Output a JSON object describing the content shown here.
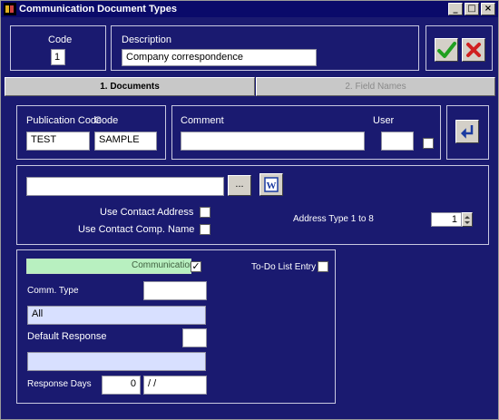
{
  "window": {
    "title": "Communication Document Types"
  },
  "window_buttons": {
    "minimize": "_",
    "maximize": "□",
    "close": "×"
  },
  "header": {
    "code_label": "Code",
    "code_value": "1",
    "description_label": "Description",
    "description_value": "Company correspondence"
  },
  "tabs": [
    {
      "label": "1. Documents"
    },
    {
      "label": "2. Field Names"
    }
  ],
  "documents": {
    "publication_code_label": "Publication Code",
    "code_label": "Code",
    "publication_code_value": "TEST",
    "code_value": "SAMPLE",
    "comment_label": "Comment",
    "comment_value": "",
    "user_label": "User",
    "user_value": "",
    "path_value": "",
    "browse_label": "...",
    "word_label": "W",
    "use_contact_address_label": "Use Contact Address",
    "use_contact_comp_name_label": "Use Contact Comp. Name",
    "address_type_label": "Address Type 1 to 8",
    "address_type_value": "1"
  },
  "communication": {
    "communication_label": "Communication",
    "communication_checked": "✓",
    "comm_type_label": "Comm. Type",
    "comm_type_value": "",
    "comm_type_desc": "All",
    "default_response_label": "Default Response",
    "default_response_value": "",
    "default_response_desc": "",
    "response_days_label": "Response Days",
    "response_days_value": "0",
    "response_date_value": "/ /",
    "todo_label": "To-Do List Entry"
  },
  "colors": {
    "background": "#1a1a70",
    "ok": "#20a020",
    "cancel": "#d02020"
  }
}
